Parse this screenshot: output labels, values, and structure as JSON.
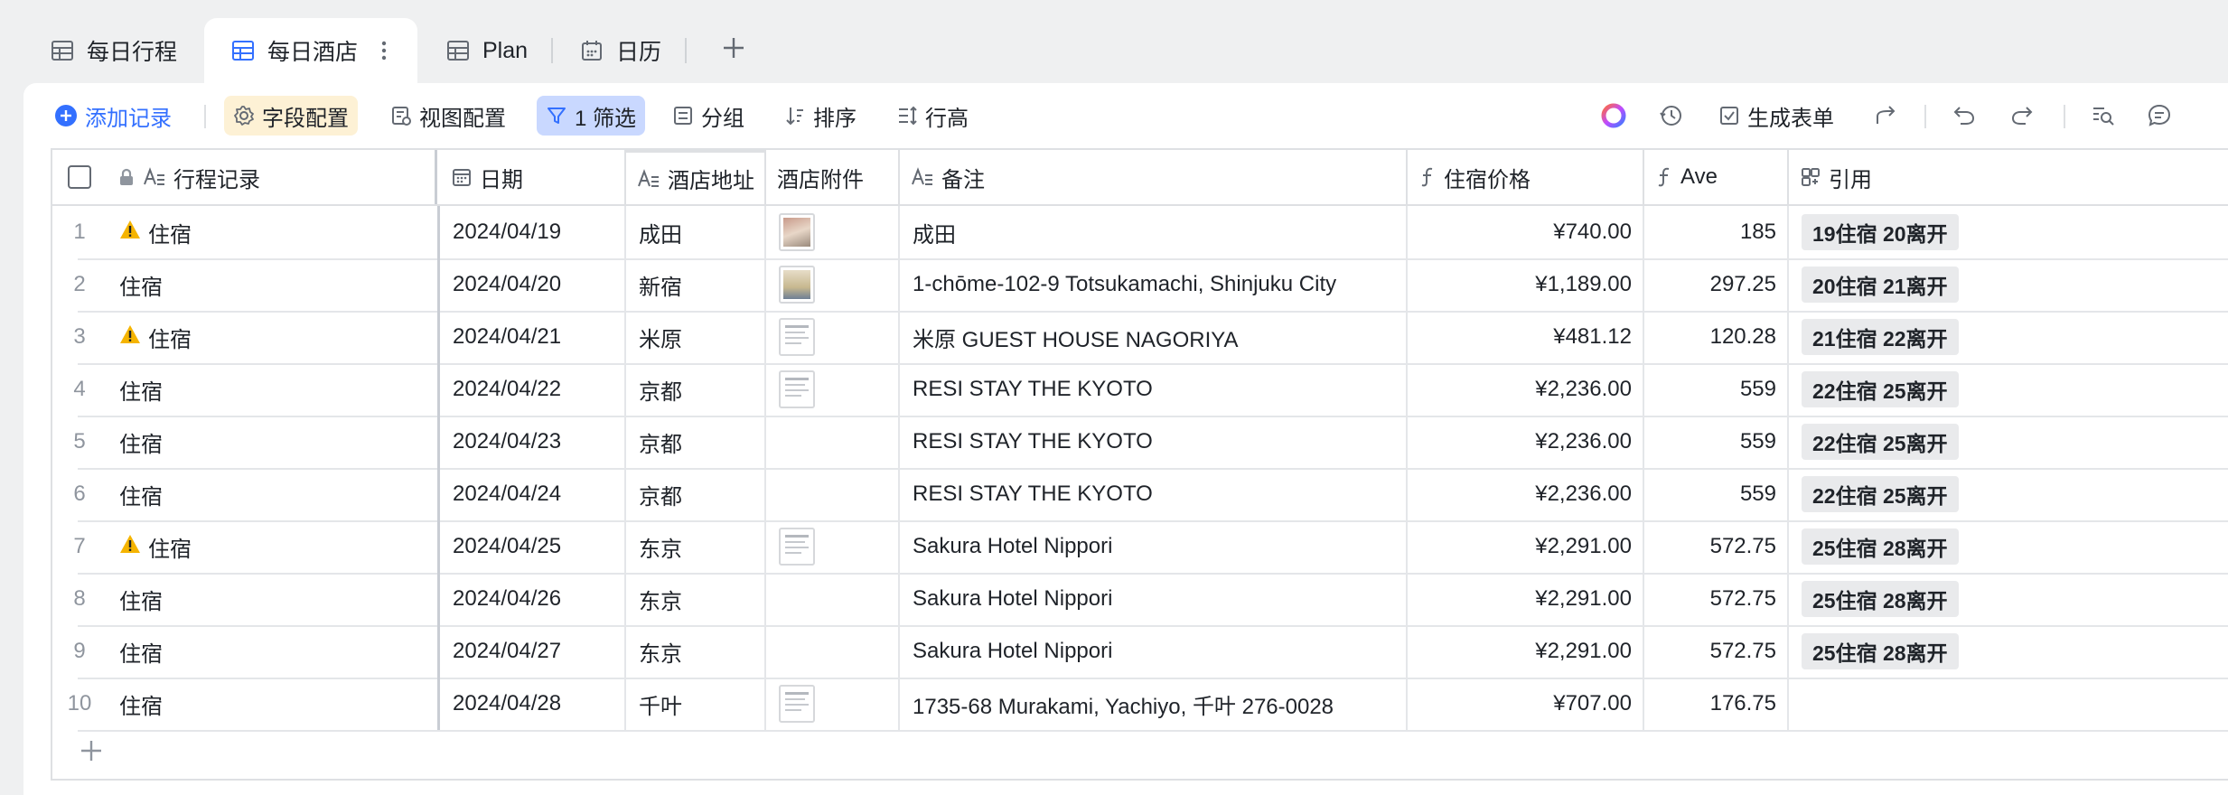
{
  "tabs": [
    {
      "label": "每日行程",
      "icon": "grid-table-icon"
    },
    {
      "label": "每日酒店",
      "icon": "grid-table-icon"
    },
    {
      "label": "Plan",
      "icon": "grid-table-icon"
    },
    {
      "label": "日历",
      "icon": "calendar-icon"
    }
  ],
  "toolbar": {
    "add_record": "添加记录",
    "field_config": "字段配置",
    "view_config": "视图配置",
    "filter": "1 筛选",
    "group": "分组",
    "sort": "排序",
    "row_height": "行高",
    "generate_form": "生成表单"
  },
  "columns": [
    "行程记录",
    "日期",
    "酒店地址",
    "酒店附件",
    "备注",
    "住宿价格",
    "Ave",
    "引用"
  ],
  "rows": [
    {
      "idx": "1",
      "warn": true,
      "record": "住宿",
      "date": "2024/04/19",
      "addr": "成田",
      "attach": "photo1",
      "note": "成田",
      "price": "¥740.00",
      "ave": "185",
      "ref": "19住宿 20离开"
    },
    {
      "idx": "2",
      "warn": false,
      "record": "住宿",
      "date": "2024/04/20",
      "addr": "新宿",
      "attach": "photo2",
      "note": "1-chōme-102-9 Totsukamachi, Shinjuku City",
      "price": "¥1,189.00",
      "ave": "297.25",
      "ref": "20住宿 21离开"
    },
    {
      "idx": "3",
      "warn": true,
      "record": "住宿",
      "date": "2024/04/21",
      "addr": "米原",
      "attach": "doc",
      "note": "米原 GUEST HOUSE NAGORIYA",
      "price": "¥481.12",
      "ave": "120.28",
      "ref": "21住宿 22离开"
    },
    {
      "idx": "4",
      "warn": false,
      "record": "住宿",
      "date": "2024/04/22",
      "addr": "京都",
      "attach": "doc",
      "note": "RESI STAY THE KYOTO",
      "price": "¥2,236.00",
      "ave": "559",
      "ref": "22住宿 25离开"
    },
    {
      "idx": "5",
      "warn": false,
      "record": "住宿",
      "date": "2024/04/23",
      "addr": "京都",
      "attach": "",
      "note": "RESI STAY THE KYOTO",
      "price": "¥2,236.00",
      "ave": "559",
      "ref": "22住宿 25离开"
    },
    {
      "idx": "6",
      "warn": false,
      "record": "住宿",
      "date": "2024/04/24",
      "addr": "京都",
      "attach": "",
      "note": "RESI STAY THE KYOTO",
      "price": "¥2,236.00",
      "ave": "559",
      "ref": "22住宿 25离开"
    },
    {
      "idx": "7",
      "warn": true,
      "record": "住宿",
      "date": "2024/04/25",
      "addr": "东京",
      "attach": "doc",
      "note": "Sakura Hotel Nippori",
      "price": "¥2,291.00",
      "ave": "572.75",
      "ref": "25住宿 28离开"
    },
    {
      "idx": "8",
      "warn": false,
      "record": "住宿",
      "date": "2024/04/26",
      "addr": "东京",
      "attach": "",
      "note": "Sakura Hotel Nippori",
      "price": "¥2,291.00",
      "ave": "572.75",
      "ref": "25住宿 28离开"
    },
    {
      "idx": "9",
      "warn": false,
      "record": "住宿",
      "date": "2024/04/27",
      "addr": "东京",
      "attach": "",
      "note": "Sakura Hotel Nippori",
      "price": "¥2,291.00",
      "ave": "572.75",
      "ref": "25住宿 28离开"
    },
    {
      "idx": "10",
      "warn": false,
      "record": "住宿",
      "date": "2024/04/28",
      "addr": "千叶",
      "attach": "doc",
      "note": "1735-68 Murakami, Yachiyo, 千叶 276-0028",
      "price": "¥707.00",
      "ave": "176.75",
      "ref": ""
    }
  ],
  "colors": {
    "accent": "#3370ff",
    "filter_bg": "#c9d8ff",
    "field_bg": "#fdf1d5",
    "warn": "#f5b400"
  }
}
